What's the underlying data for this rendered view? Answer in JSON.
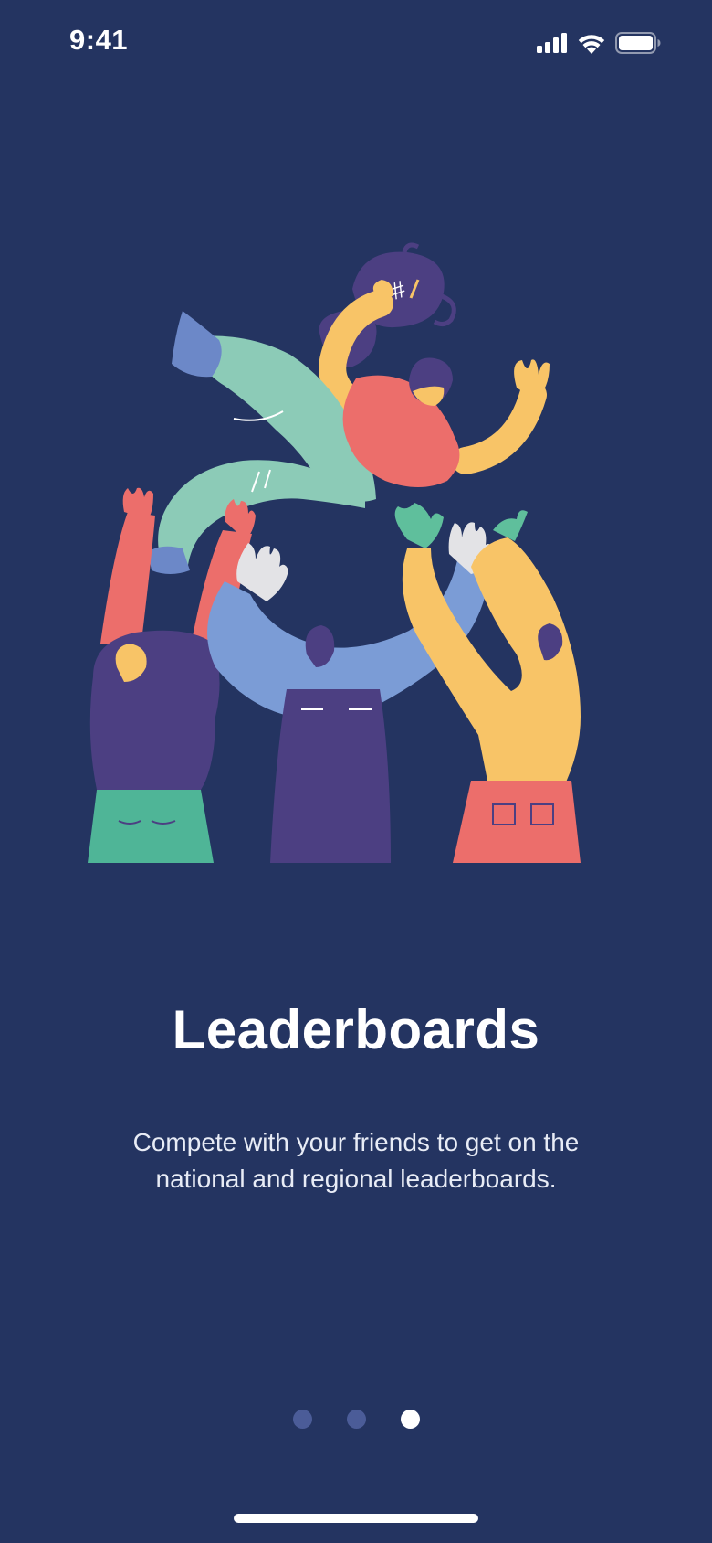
{
  "status_bar": {
    "time": "9:41",
    "icons": [
      "signal-icon",
      "wifi-icon",
      "battery-icon"
    ]
  },
  "onboarding": {
    "illustration": "people-lifting-trophy-winner-illustration",
    "title": "Leaderboards",
    "description": "Compete with your friends to get on the national and regional leaderboards."
  },
  "pager": {
    "count": 3,
    "active_index": 2
  },
  "colors": {
    "background": "#243461",
    "dot_inactive": "#4b5c98",
    "dot_active": "#ffffff"
  }
}
